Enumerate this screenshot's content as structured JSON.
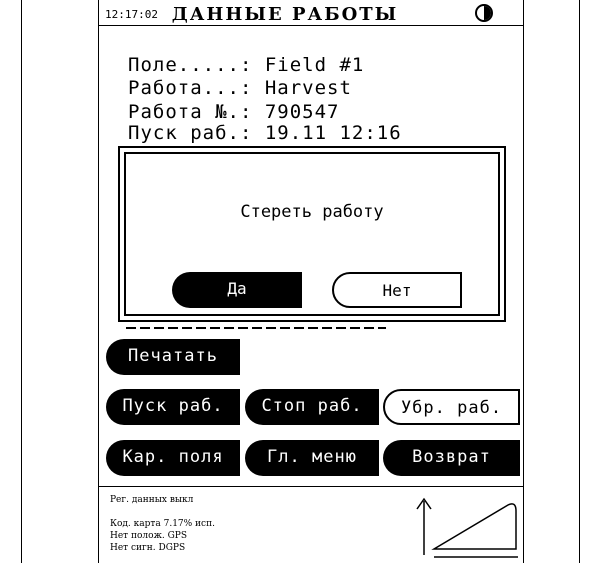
{
  "header": {
    "time": "12:17:02",
    "title": "ДАННЫЕ РАБОТЫ",
    "contrast_icon": "contrast-icon"
  },
  "info": {
    "field": "Поле.....: Field #1",
    "job": "Работа...: Harvest",
    "job_number": "Работа №.: 790547",
    "start": "Пуск раб.: 19.11 12:16"
  },
  "dialog": {
    "message": "Стереть работу",
    "yes": "Да",
    "no": "Нет"
  },
  "buttons": {
    "print": "Печатать",
    "start_job": "Пуск раб.",
    "stop_job": "Стоп раб.",
    "remove_job": "Убр. раб.",
    "field_map": "Кар. поля",
    "main_menu": "Гл. меню",
    "back": "Возврат"
  },
  "status": {
    "data_log": "Рег. данных выкл",
    "map_code": "Код. карта  7.17% исп.",
    "no_position": "Нет полож. GPS",
    "no_signal": "Нет сигн. DGPS"
  }
}
